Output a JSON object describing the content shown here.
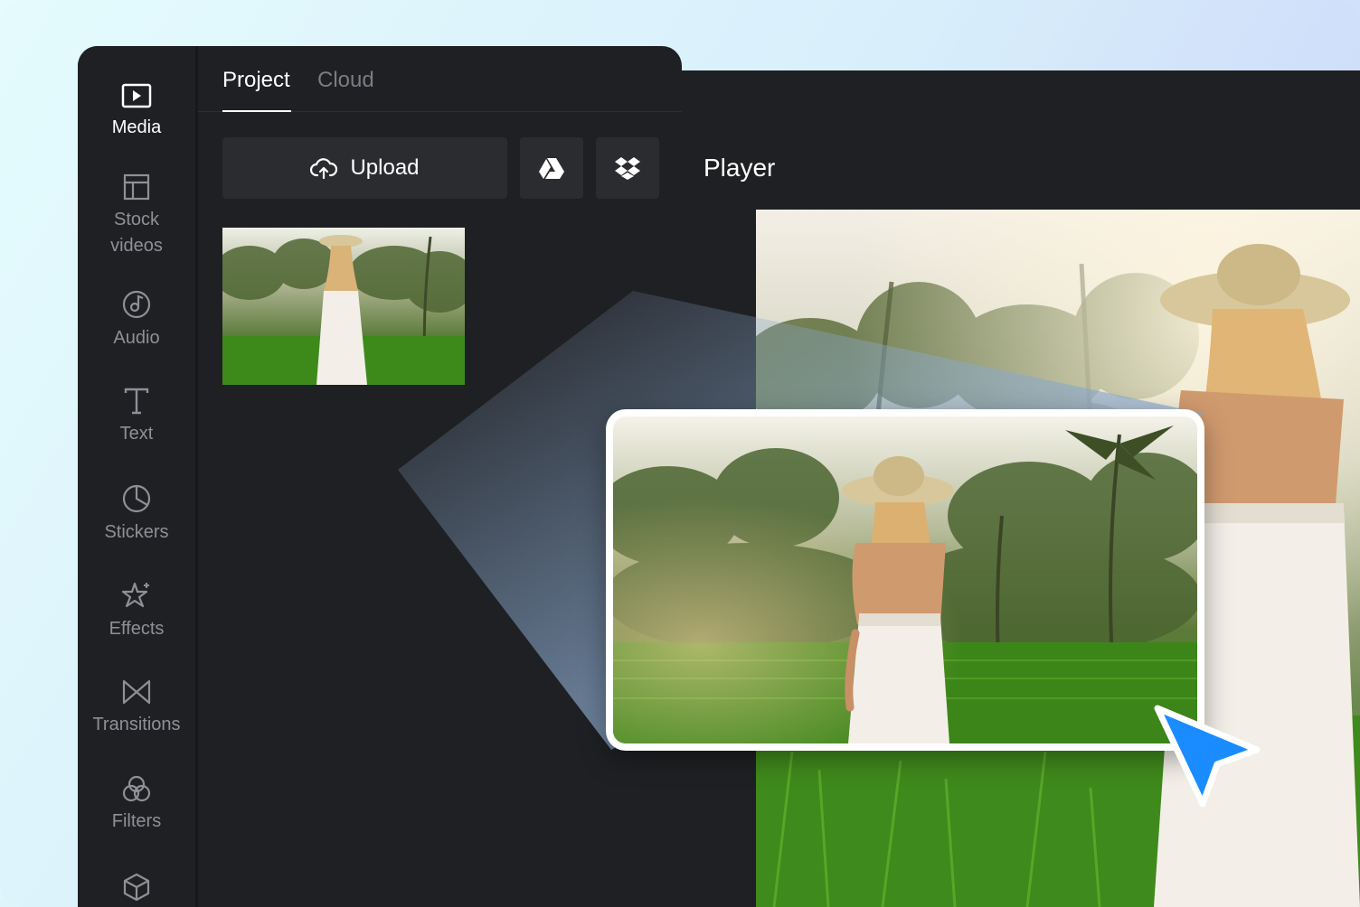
{
  "colors": {
    "panel": "#1f2023",
    "button": "#2b2c30",
    "accent_cursor": "#1a8cff"
  },
  "sidebar": {
    "items": [
      {
        "label": "Media",
        "icon": "play-square-icon",
        "active": true
      },
      {
        "label": "Stock videos",
        "icon": "layout-icon",
        "active": false
      },
      {
        "label": "Audio",
        "icon": "music-disc-icon",
        "active": false
      },
      {
        "label": "Text",
        "icon": "text-t-icon",
        "active": false
      },
      {
        "label": "Stickers",
        "icon": "sticker-icon",
        "active": false
      },
      {
        "label": "Effects",
        "icon": "sparkle-star-icon",
        "active": false
      },
      {
        "label": "Transitions",
        "icon": "bowtie-icon",
        "active": false
      },
      {
        "label": "Filters",
        "icon": "filters-circles-icon",
        "active": false
      },
      {
        "label": "",
        "icon": "cube-icon",
        "active": false
      }
    ]
  },
  "tabs": [
    {
      "label": "Project",
      "active": true
    },
    {
      "label": "Cloud",
      "active": false
    }
  ],
  "toolbar": {
    "upload_label": "Upload",
    "gdrive_icon": "google-drive-icon",
    "dropbox_icon": "dropbox-icon"
  },
  "player": {
    "title": "Player"
  },
  "media": {
    "thumbnail": "woman-in-sun-hat-rice-field"
  }
}
